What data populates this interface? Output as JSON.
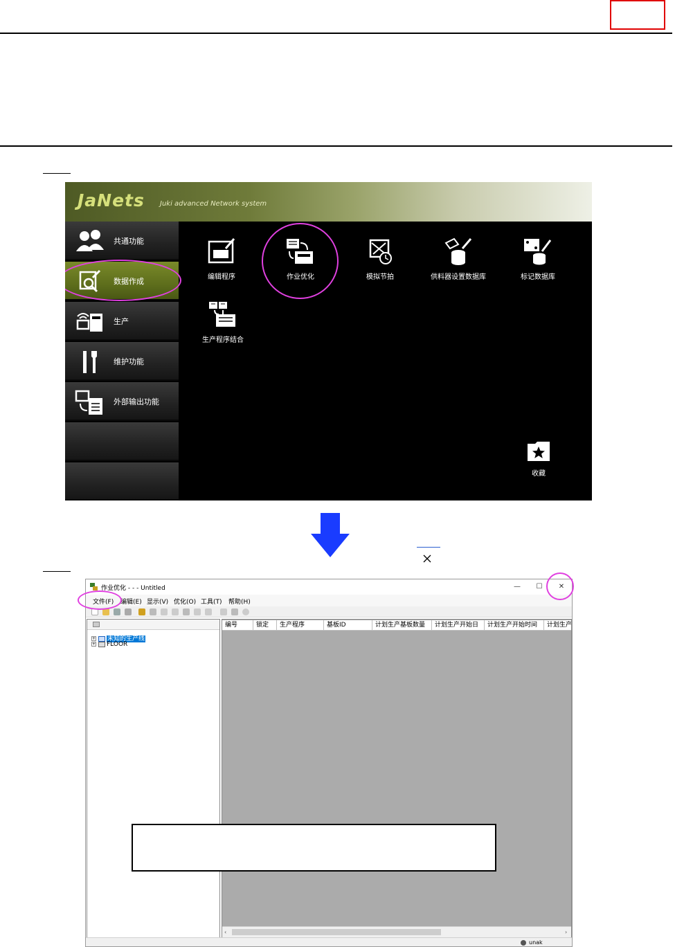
{
  "janets": {
    "logo": "JaNets",
    "subtitle": "Juki advanced Network system",
    "nav": [
      {
        "label": "共通功能",
        "icon": "users-icon"
      },
      {
        "label": "数据作成",
        "icon": "data-edit-icon"
      },
      {
        "label": "生产",
        "icon": "production-icon"
      },
      {
        "label": "维护功能",
        "icon": "maintenance-tools-icon"
      },
      {
        "label": "外部输出功能",
        "icon": "export-icon"
      }
    ],
    "tiles": [
      {
        "label": "编辑程序",
        "icon": "edit-program-icon"
      },
      {
        "label": "作业优化",
        "icon": "job-optimize-icon"
      },
      {
        "label": "模拟节拍",
        "icon": "simulate-tact-icon"
      },
      {
        "label": "供料器设置数据库",
        "icon": "feeder-db-icon"
      },
      {
        "label": "标记数据库",
        "icon": "mark-db-icon"
      },
      {
        "label": "生产程序结合",
        "icon": "program-merge-icon"
      },
      {
        "label": "收藏",
        "icon": "favorites-star-icon"
      }
    ]
  },
  "window": {
    "title": "作业优化 - - - Untitled",
    "controls": {
      "minimize": "—",
      "maximize": "☐",
      "close": "✕"
    },
    "menu": [
      "文件(F)",
      "编辑(E)",
      "显示(V)",
      "优化(O)",
      "工具(T)",
      "帮助(H)"
    ],
    "tree": [
      {
        "label": "未知的生产线",
        "selected": true
      },
      {
        "label": "FLOOR",
        "selected": false
      }
    ],
    "columns": [
      "编号",
      "锁定",
      "生产程序",
      "基板ID",
      "计划生产基板数量",
      "计划生产开始日",
      "计划生产开始时间",
      "计划生产"
    ],
    "status_user": "unak"
  },
  "colors": {
    "highlight_circle": "#e040e0",
    "red_box": "#e00000",
    "arrow": "#1a3cff",
    "janets_active": "#5e6e1c"
  }
}
